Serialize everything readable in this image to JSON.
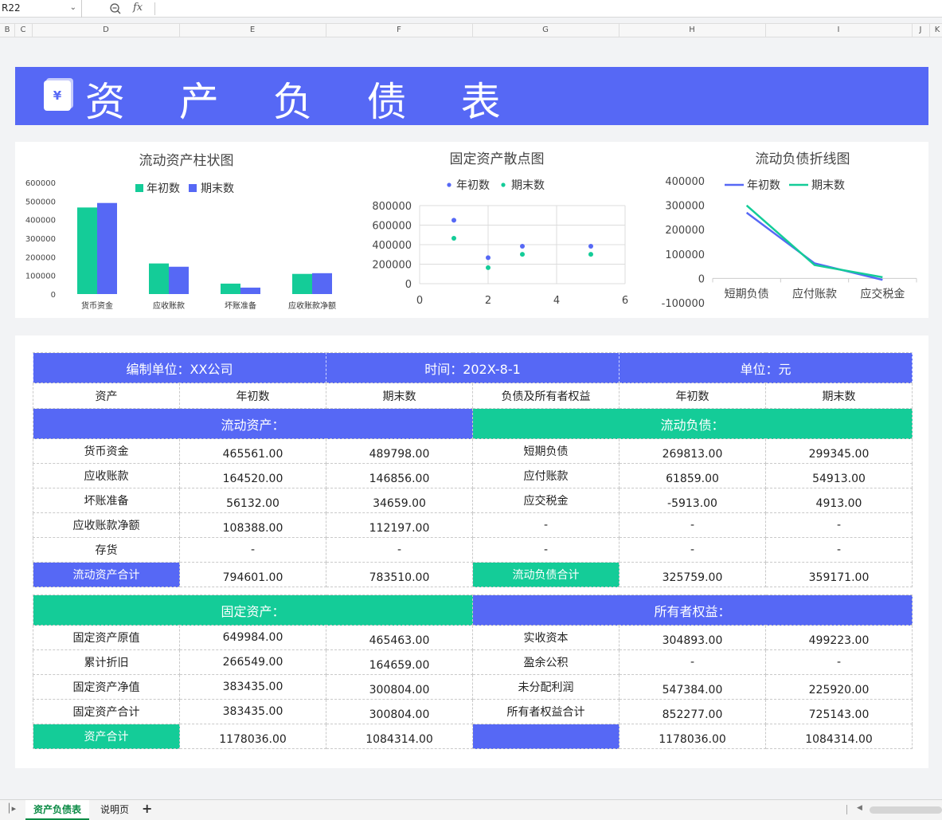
{
  "formula_bar": {
    "cell_ref": "R22",
    "fx_label": "fx",
    "zoom_icon": "zoom-icon"
  },
  "columns": [
    "B",
    "C",
    "D",
    "E",
    "F",
    "G",
    "H",
    "I",
    "J",
    "K"
  ],
  "banner": {
    "title": "资 产 负 债 表",
    "icon_glyph": "¥",
    "color": "#5668f5"
  },
  "colors": {
    "primary": "#5668f5",
    "accent": "#14cc98"
  },
  "charts": {
    "bar_title": "流动资产柱状图",
    "scatter_title": "固定资产散点图",
    "line_title": "流动负债折线图",
    "legend_start": "年初数",
    "legend_end": "期末数"
  },
  "chart_data": [
    {
      "type": "bar",
      "title": "流动资产柱状图",
      "categories": [
        "货币资金",
        "应收账款",
        "坏账准备",
        "应收账款净额"
      ],
      "series": [
        {
          "name": "年初数",
          "values": [
            465561,
            164520,
            56132,
            108388
          ],
          "color": "#14cc98"
        },
        {
          "name": "期末数",
          "values": [
            489798,
            146856,
            34659,
            112197
          ],
          "color": "#5668f5"
        }
      ],
      "ylim": [
        0,
        600000
      ],
      "yticks": [
        "600000",
        "500000",
        "400000",
        "300000",
        "200000",
        "100000",
        "0"
      ],
      "legend": "top",
      "grid": false
    },
    {
      "type": "scatter",
      "title": "固定资产散点图",
      "series": [
        {
          "name": "年初数",
          "points": [
            [
              1,
              649984
            ],
            [
              2,
              266549
            ],
            [
              3,
              383435
            ],
            [
              5,
              383435
            ]
          ],
          "color": "#5668f5"
        },
        {
          "name": "期末数",
          "points": [
            [
              1,
              465463
            ],
            [
              2,
              164659
            ],
            [
              3,
              300804
            ],
            [
              5,
              300804
            ]
          ],
          "color": "#14cc98"
        }
      ],
      "xlim": [
        0,
        6
      ],
      "ylim": [
        0,
        800000
      ],
      "xticks": [
        "0",
        "2",
        "4",
        "6"
      ],
      "yticks": [
        "800000",
        "600000",
        "400000",
        "200000",
        "0"
      ],
      "legend": "top",
      "grid": true
    },
    {
      "type": "line",
      "title": "流动负债折线图",
      "categories": [
        "短期负债",
        "应付账款",
        "应交税金"
      ],
      "series": [
        {
          "name": "年初数",
          "values": [
            269813,
            61859,
            -5913
          ],
          "color": "#5668f5"
        },
        {
          "name": "期末数",
          "values": [
            299345,
            54913,
            4913
          ],
          "color": "#14cc98"
        }
      ],
      "ylim": [
        -100000,
        400000
      ],
      "yticks": [
        "400000",
        "300000",
        "200000",
        "100000",
        "0",
        "-100000"
      ],
      "legend": "top",
      "grid": false
    }
  ],
  "table": {
    "header": {
      "unit": "编制单位：XX公司",
      "date": "时间：202X-8-1",
      "currency": "单位：元"
    },
    "col_headers": [
      "资产",
      "年初数",
      "期末数",
      "负债及所有者权益",
      "年初数",
      "期末数"
    ],
    "current_assets_label": "流动资产：",
    "current_liab_label": "流动负债：",
    "rows1": [
      [
        "货币资金",
        "465561.00",
        "489798.00",
        "短期负债",
        "269813.00",
        "299345.00"
      ],
      [
        "应收账款",
        "164520.00",
        "146856.00",
        "应付账款",
        "61859.00",
        "54913.00"
      ],
      [
        "坏账准备",
        "56132.00",
        "34659.00",
        "应交税金",
        "-5913.00",
        "4913.00"
      ],
      [
        "应收账款净额",
        "108388.00",
        "112197.00",
        "-",
        "-",
        "-"
      ],
      [
        "存货",
        "-",
        "-",
        "-",
        "-",
        "-"
      ]
    ],
    "total1": [
      "流动资产合计",
      "794601.00",
      "783510.00",
      "流动负债合计",
      "325759.00",
      "359171.00"
    ],
    "fixed_assets_label": "固定资产：",
    "equity_label": "所有者权益：",
    "rows2": [
      [
        "固定资产原值",
        "649984.00",
        "465463.00",
        "实收资本",
        "304893.00",
        "499223.00"
      ],
      [
        "累计折旧",
        "266549.00",
        "164659.00",
        "盈余公积",
        "-",
        "-"
      ],
      [
        "固定资产净值",
        "383435.00",
        "300804.00",
        "未分配利润",
        "547384.00",
        "225920.00"
      ],
      [
        "固定资产合计",
        "383435.00",
        "300804.00",
        "所有者权益合计",
        "852277.00",
        "725143.00"
      ]
    ],
    "total2": [
      "资产合计",
      "1178036.00",
      "1084314.00",
      "",
      "1178036.00",
      "1084314.00"
    ]
  },
  "tabs": {
    "active": "资产负债表",
    "other": "说明页",
    "add": "+"
  }
}
